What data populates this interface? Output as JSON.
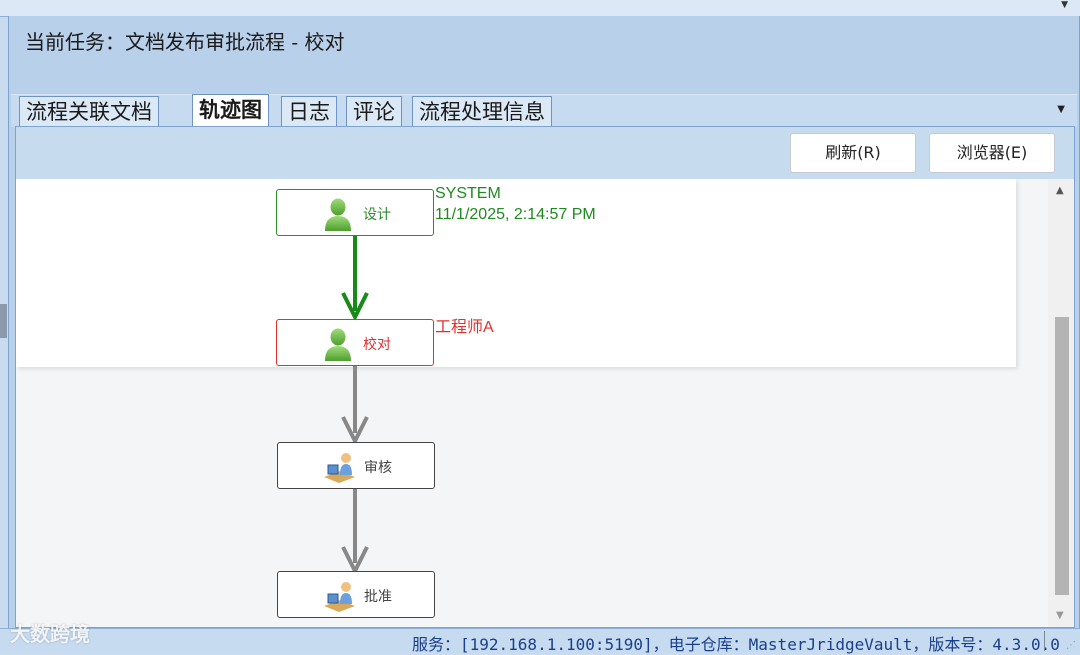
{
  "header": {
    "task_title": "当前任务：文档发布审批流程 - 校对"
  },
  "tabs": [
    {
      "label": "流程关联文档"
    },
    {
      "label": "轨迹图",
      "active": true
    },
    {
      "label": "日志"
    },
    {
      "label": "评论"
    },
    {
      "label": "流程处理信息"
    }
  ],
  "toolbar": {
    "refresh_label": "刷新(R)",
    "browser_label": "浏览器(E)"
  },
  "flow": {
    "nodes": [
      {
        "label": "设计",
        "state": "done",
        "icon": "user-icon"
      },
      {
        "label": "校对",
        "state": "current",
        "icon": "user-icon"
      },
      {
        "label": "审核",
        "state": "pending",
        "icon": "workstation-icon"
      },
      {
        "label": "批准",
        "state": "pending",
        "icon": "workstation-icon"
      }
    ],
    "design_note": {
      "user": "SYSTEM",
      "time": "11/1/2025, 2:14:57 PM"
    },
    "proofread_note": {
      "user": "工程师A"
    }
  },
  "colors": {
    "done": "#2e8b2e",
    "current": "#e03030",
    "pending": "#888888"
  },
  "status": {
    "text": "服务：[192.168.1.100:5190]，电子仓库：MasterJridgeVault，版本号：4.3.0.0"
  },
  "watermark": {
    "text": "大数跨境"
  }
}
